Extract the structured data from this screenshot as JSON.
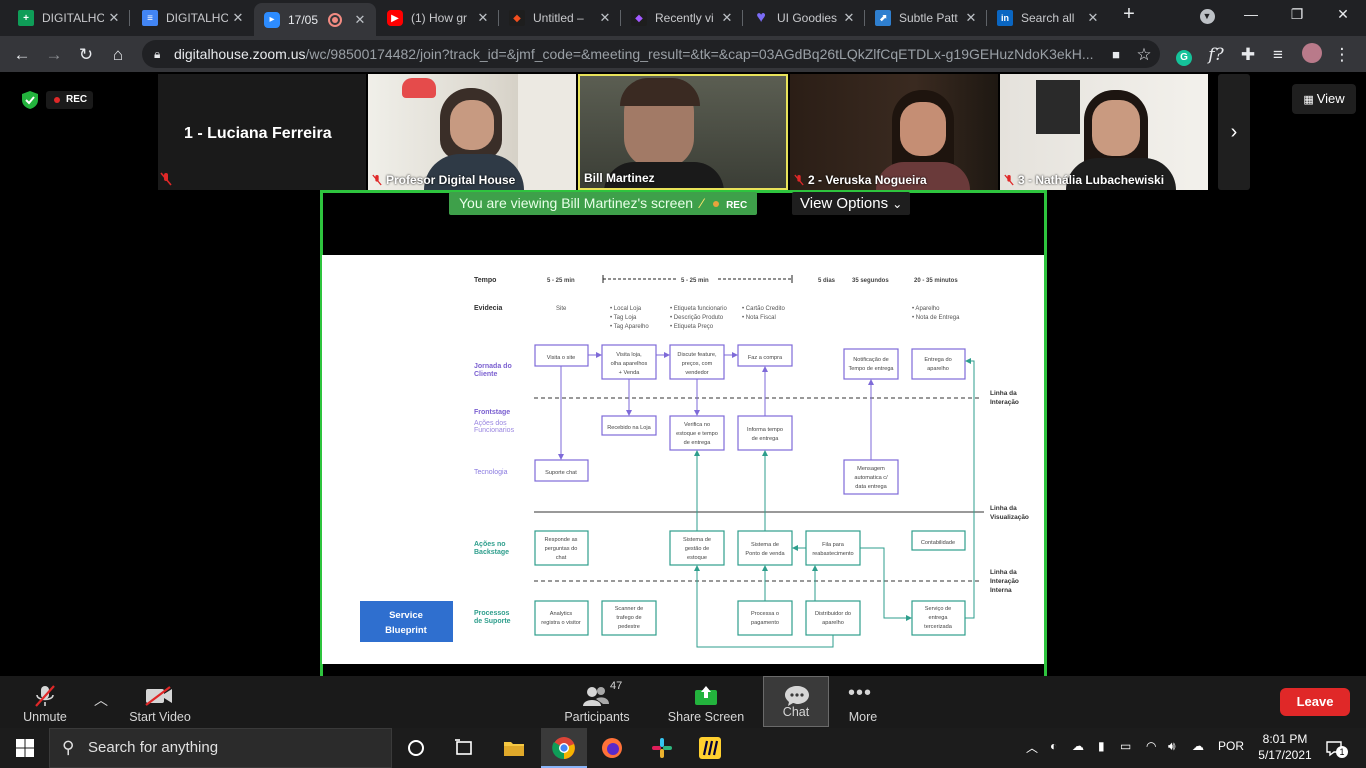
{
  "browser": {
    "tabs": [
      {
        "label": "DIGITALHC",
        "icon": "sheets-icon",
        "color": "#0f9d58"
      },
      {
        "label": "DIGITALHC",
        "icon": "docs-icon",
        "color": "#4285f4"
      },
      {
        "label": "17/05",
        "icon": "zoom-icon",
        "color": "#2d8cff"
      },
      {
        "label": "(1) How gr",
        "icon": "youtube-icon",
        "color": "#ff0000"
      },
      {
        "label": "Untitled – ",
        "icon": "figma-icon",
        "color": "#a259ff"
      },
      {
        "label": "Recently vi",
        "icon": "figma-icon",
        "color": "#a259ff"
      },
      {
        "label": "UI Goodies",
        "icon": "heart-icon",
        "color": "#7b6cf6"
      },
      {
        "label": "Subtle Patt",
        "icon": "subtle-patterns-icon",
        "color": "#2f7fcf"
      },
      {
        "label": "Search all ",
        "icon": "linkedin-icon",
        "color": "#0a66c2"
      }
    ],
    "url_domain": "digitalhouse.zoom.us",
    "url_path": "/wc/98500174482/join?track_id=&jmf_code=&meeting_result=&tk=&cap=03AGdBq26tLQkZlfCqETDLx-g19GEHuzNdoK3ekH..."
  },
  "zoom": {
    "rec_label": "REC",
    "host_name": "1 - Luciana Ferreira",
    "participants": [
      {
        "name": "Profesor Digital House",
        "muted": true
      },
      {
        "name": "Bill Martinez",
        "muted": false
      },
      {
        "name": "2 - Veruska Nogueira",
        "muted": true
      },
      {
        "name": "3 - Nathália Lubachewiski",
        "muted": true
      }
    ],
    "view_label": "View",
    "banner": "You are viewing Bill Martinez's screen",
    "banner_rec": "REC",
    "view_options": "View Options",
    "toolbar": {
      "unmute": "Unmute",
      "start_video": "Start Video",
      "participants": "Participants",
      "participants_count": "47",
      "share_screen": "Share Screen",
      "chat": "Chat",
      "more": "More",
      "leave": "Leave"
    }
  },
  "blueprint": {
    "title": "Service Blueprint",
    "row_labels": {
      "tempo": "Tempo",
      "evidencia": "Evidecia",
      "jornada": "Jornada do Cliente",
      "frontstage": "Frontstage",
      "acoes_func": "Ações dos Funcionarios",
      "tecnologia": "Tecnologia",
      "backstage": "Ações no Backstage",
      "suporte": "Processos de Suporte"
    },
    "times": [
      "5 - 25 min",
      "5 - 25 min",
      "5 dias",
      "35 segundos",
      "20 - 35 minutos"
    ],
    "evidence": {
      "site": "Site",
      "loja": [
        "• Local Loja",
        "• Tag Loja",
        "• Tag Aparelho"
      ],
      "etiquetas": [
        "• Etiqueta funcionario",
        "• Descrição Produto",
        "• Etiqueta Preço"
      ],
      "cartao": [
        "• Cartão Credito",
        "• Nota Fiscal"
      ],
      "aparelho": [
        "• Aparelho",
        "• Nota de Entrega"
      ]
    },
    "lines": {
      "interacao": "Linha da Interação",
      "visualizacao": "Linha da Visualização",
      "interna": "Linha da Interação Interna"
    },
    "boxes": {
      "visita_site": "Visita o site",
      "visita_loja": "Visita loja, olha aparelhos + Venda",
      "discute": "Discute feature, preços, com vendedor",
      "faz_compra": "Faz a compra",
      "notificacao": "Notificação de Tempo de entrega",
      "entrega_aparelho": "Entrega do aparelho",
      "recebido": "Recebido na Loja",
      "verifica": "Verifica no estoque e tempo de entrega",
      "informa": "Informa tempo de entrega",
      "suporte_chat": "Suporte chat",
      "mensagem": "Mensagem automatica c/ data entrega",
      "responde": "Responde as perguntas do chat",
      "sistema_estoque": "Sistema de gestão de estoque",
      "sistema_venda": "Sistema de Ponto de venda",
      "fila": "Fila para reabastecimento",
      "contabilidade": "Contabilidade",
      "analytics": "Analytics registra o visitor",
      "scanner": "Scanner de trafego de pedestre",
      "processa": "Processa o pagamento",
      "distribuidor": "Distribuidor do aparelho",
      "servico": "Serviço de entrega tercerizada"
    }
  },
  "taskbar": {
    "search_placeholder": "Search for anything",
    "lang": "POR",
    "time": "8:01 PM",
    "date": "5/17/2021",
    "notif_count": "1"
  }
}
